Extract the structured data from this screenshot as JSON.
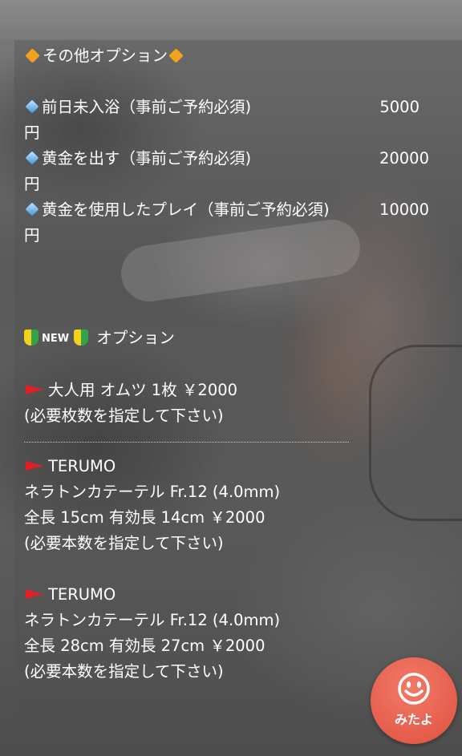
{
  "other_options": {
    "title": "その他オプション",
    "items": [
      {
        "name": "前日未入浴（事前ご予約必須)",
        "price": "5000",
        "unit": "円"
      },
      {
        "name": "黄金を出す（事前ご予約必須)",
        "price": "20000",
        "unit": "円"
      },
      {
        "name": "黄金を使用したプレイ（事前ご予約必須)",
        "price": "10000",
        "unit": "円"
      }
    ]
  },
  "new_options": {
    "new_label": "NEW",
    "title": "オプション",
    "items": [
      {
        "title": "大人用 オムツ 1枚 ￥2000",
        "lines": [
          "(必要枚数を指定して下さい)"
        ]
      },
      {
        "title": "TERUMO",
        "lines": [
          "ネラトンカテーテル Fr.12 (4.0mm)",
          "全長 15cm 有効長 14cm ￥2000",
          "(必要本数を指定して下さい)"
        ]
      },
      {
        "title": "TERUMO",
        "lines": [
          "ネラトンカテーテル Fr.12 (4.0mm)",
          "全長 28cm 有効長 27cm ￥2000",
          "(必要本数を指定して下さい)"
        ]
      }
    ]
  },
  "floating_button": {
    "label": "みたよ",
    "icon": "smiley-icon"
  },
  "icons": {
    "diamond": "orange-diamond-icon",
    "sparkle": "blue-diamond-icon",
    "beginner": "beginner-mark-icon",
    "flag": "red-flag-icon"
  },
  "colors": {
    "accent": "#f2a21d",
    "button": "#e0503f",
    "flag": "#e01f26"
  }
}
